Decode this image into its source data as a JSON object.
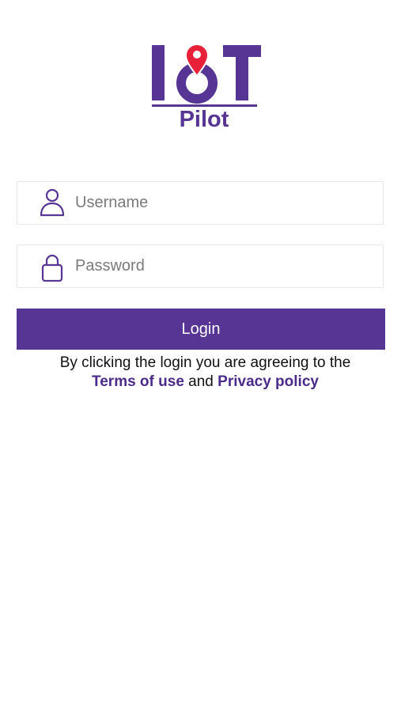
{
  "logo": {
    "word": "IoT",
    "subtitle": "Pilot",
    "primary_color": "#563594",
    "pin_color": "#e8203a"
  },
  "username": {
    "placeholder": "Username",
    "icon": "user-icon"
  },
  "password": {
    "placeholder": "Password",
    "icon": "lock-icon"
  },
  "login_button": {
    "label": "Login",
    "color": "#563594"
  },
  "terms": {
    "line1": "By clicking the login you are agreeing to the",
    "terms_link": "Terms of use",
    "conjunction": "and",
    "privacy_link": "Privacy policy",
    "link_color": "#4b2c8a"
  }
}
